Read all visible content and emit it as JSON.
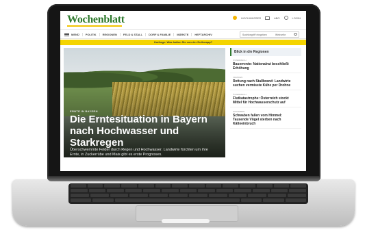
{
  "site": {
    "logo": "Wochenblatt",
    "top_links": {
      "weather": "HOCHWASSER",
      "abo": "ABO",
      "login": "LOGIN"
    }
  },
  "nav": {
    "menu_label": "MENÜ",
    "items": [
      "POLITIK",
      "REGIONEN",
      "FELD & STALL",
      "DORF & FAMILIE",
      "MÄRKTE",
      "HEFTARCHIV"
    ],
    "search_placeholder": "Suchbegriff eingeben",
    "search_option": "Webseite"
  },
  "banner": {
    "text": "Umfrage: Was halten Sie von der Dullenapp?"
  },
  "hero": {
    "kicker": "ERNTE IN BAYERN",
    "headline": "Die Erntesituation in Bayern nach Hochwasser und Starkregen",
    "lead": "Überschwemmte Felder durch Regen und Hochwasser. Landwirte fürchten um ihre Ernte, in Zuckerrübe und Mais gibt es erste Prognosen."
  },
  "sidebar": {
    "heading": "Blick in die Regionen",
    "items": [
      {
        "category": "ÖSTERREICH",
        "title": "Bauerrente: Nationalrat beschließt Erhöhung"
      },
      {
        "category": "FRANKEN",
        "title": "Rettung nach Stallbrand: Landwirte suchen vermisste Kühe per Drohne"
      },
      {
        "category": "ÖSTERREICH",
        "title": "Flutkatastrophe: Österreich stockt Mittel für Hochwasserschutz auf"
      },
      {
        "category": "SCHWABEN",
        "title": "Schwaben fallen vom Himmel: Tausende Vögel sterben nach Kälteeinbruch"
      }
    ]
  },
  "colors": {
    "brand_green": "#2f7a2e",
    "banner_yellow": "#f4d400"
  }
}
